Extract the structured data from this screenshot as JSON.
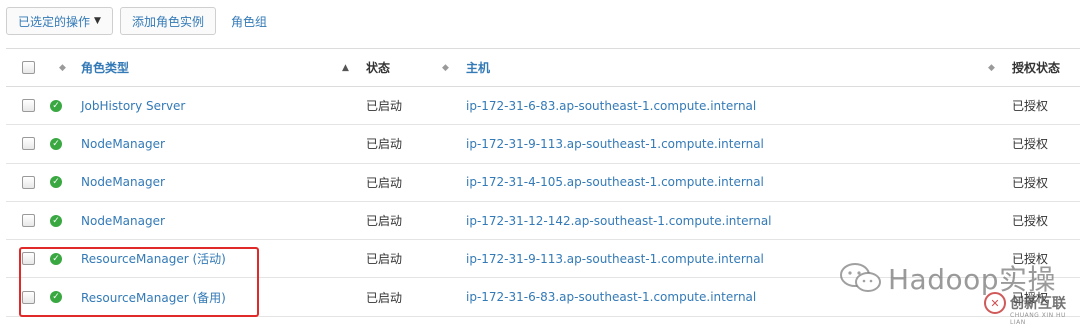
{
  "toolbar": {
    "selected_actions_label": "已选定的操作",
    "add_role_instance_label": "添加角色实例",
    "role_groups_label": "角色组"
  },
  "table": {
    "headers": {
      "role_type": "角色类型",
      "status": "状态",
      "host": "主机",
      "auth_status": "授权状态"
    },
    "rows": [
      {
        "role": "JobHistory Server",
        "status": "已启动",
        "host": "ip-172-31-6-83.ap-southeast-1.compute.internal",
        "auth": "已授权"
      },
      {
        "role": "NodeManager",
        "status": "已启动",
        "host": "ip-172-31-9-113.ap-southeast-1.compute.internal",
        "auth": "已授权"
      },
      {
        "role": "NodeManager",
        "status": "已启动",
        "host": "ip-172-31-4-105.ap-southeast-1.compute.internal",
        "auth": "已授权"
      },
      {
        "role": "NodeManager",
        "status": "已启动",
        "host": "ip-172-31-12-142.ap-southeast-1.compute.internal",
        "auth": "已授权"
      },
      {
        "role": "ResourceManager (活动)",
        "status": "已启动",
        "host": "ip-172-31-9-113.ap-southeast-1.compute.internal",
        "auth": "已授权"
      },
      {
        "role": "ResourceManager (备用)",
        "status": "已启动",
        "host": "ip-172-31-6-83.ap-southeast-1.compute.internal",
        "auth": "已授权"
      }
    ]
  },
  "watermark": {
    "text": "Hadoop实操",
    "brand": "创新互联",
    "brand_sub": "CHUANG XIN HU LIAN"
  },
  "colors": {
    "link": "#337ab7",
    "ok": "#3aa841",
    "highlight": "#e02a2a"
  }
}
